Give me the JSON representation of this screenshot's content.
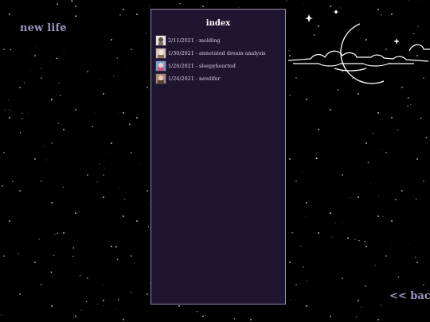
{
  "site": {
    "title": "new life",
    "back_link": "<< back"
  },
  "index": {
    "heading": "index",
    "entries": [
      {
        "label": "2/11/2021 - molding",
        "thumb_color": "#e9e4dc"
      },
      {
        "label": "1/30/2021 - annotated dream analysis",
        "thumb_color": "#d4c3b4"
      },
      {
        "label": "1/26/2021 - sleepyhearted",
        "thumb_color": "#7a9fd0"
      },
      {
        "label": "1/24/2021 - newlifer",
        "thumb_color": "#a78a7a"
      }
    ]
  },
  "colors": {
    "background": "#000000",
    "panel": "#201530",
    "panel_border": "#8f8aa8",
    "accent_text": "#9a95bf",
    "entry_text": "#d9d4ea"
  },
  "icons": {
    "moon": "crescent-moon-icon",
    "clouds": "cloud-line-art",
    "stars": "sparkle-star-icon"
  }
}
